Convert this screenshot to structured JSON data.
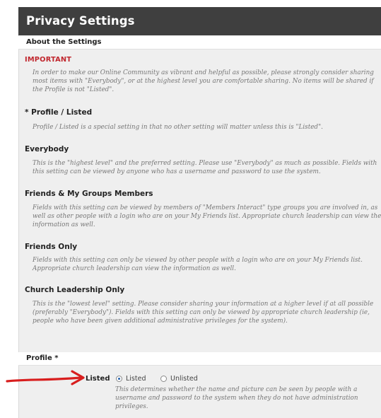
{
  "header": {
    "title": "Privacy Settings"
  },
  "about": {
    "label": "About the Settings"
  },
  "sections": [
    {
      "heading": "IMPORTANT",
      "text": "In order to make our Online Community as vibrant and helpful as possible, please strongly consider sharing most items with \"Everybody\", or at the highest level you are comfortable sharing. No items will be shared if the Profile is not \"Listed\"."
    },
    {
      "heading": "* Profile / Listed",
      "text": "Profile / Listed is a special setting in that no other setting will matter unless this is \"Listed\"."
    },
    {
      "heading": "Everybody",
      "text": "This is the \"highest level\" and the preferred setting. Please use \"Everybody\" as much as possible. Fields with this setting can be viewed by anyone who has a username and password to use the system."
    },
    {
      "heading": "Friends & My Groups Members",
      "text": "Fields with this setting can be viewed by members of \"Members Interact\" type groups you are involved in, as well as other people with a login who are on your My Friends list. Appropriate church leadership can view the information as well."
    },
    {
      "heading": "Friends Only",
      "text": "Fields with this setting can only be viewed by other people with a login who are on your My Friends list. Appropriate church leadership can view the information as well."
    },
    {
      "heading": "Church Leadership Only",
      "text": "This is the \"lowest level\" setting. Please consider sharing your information at a higher level if at all possible (preferably \"Everybody\"). Fields with this setting can only be viewed by appropriate church leadership (ie, people who have been given additional administrative privileges for the system)."
    }
  ],
  "profile": {
    "label": "Profile *",
    "field_label": "Listed",
    "options": [
      {
        "label": "Listed",
        "selected": true
      },
      {
        "label": "Unlisted",
        "selected": false
      }
    ],
    "help": "This determines whether the name and picture can be seen by people with a username and password to the system when they do not have administration privileges."
  },
  "colors": {
    "title_bar": "#3f3f3f",
    "important": "#c0262d",
    "annotation_arrow": "#d81e1e",
    "radio_selected": "#1f5fae"
  }
}
